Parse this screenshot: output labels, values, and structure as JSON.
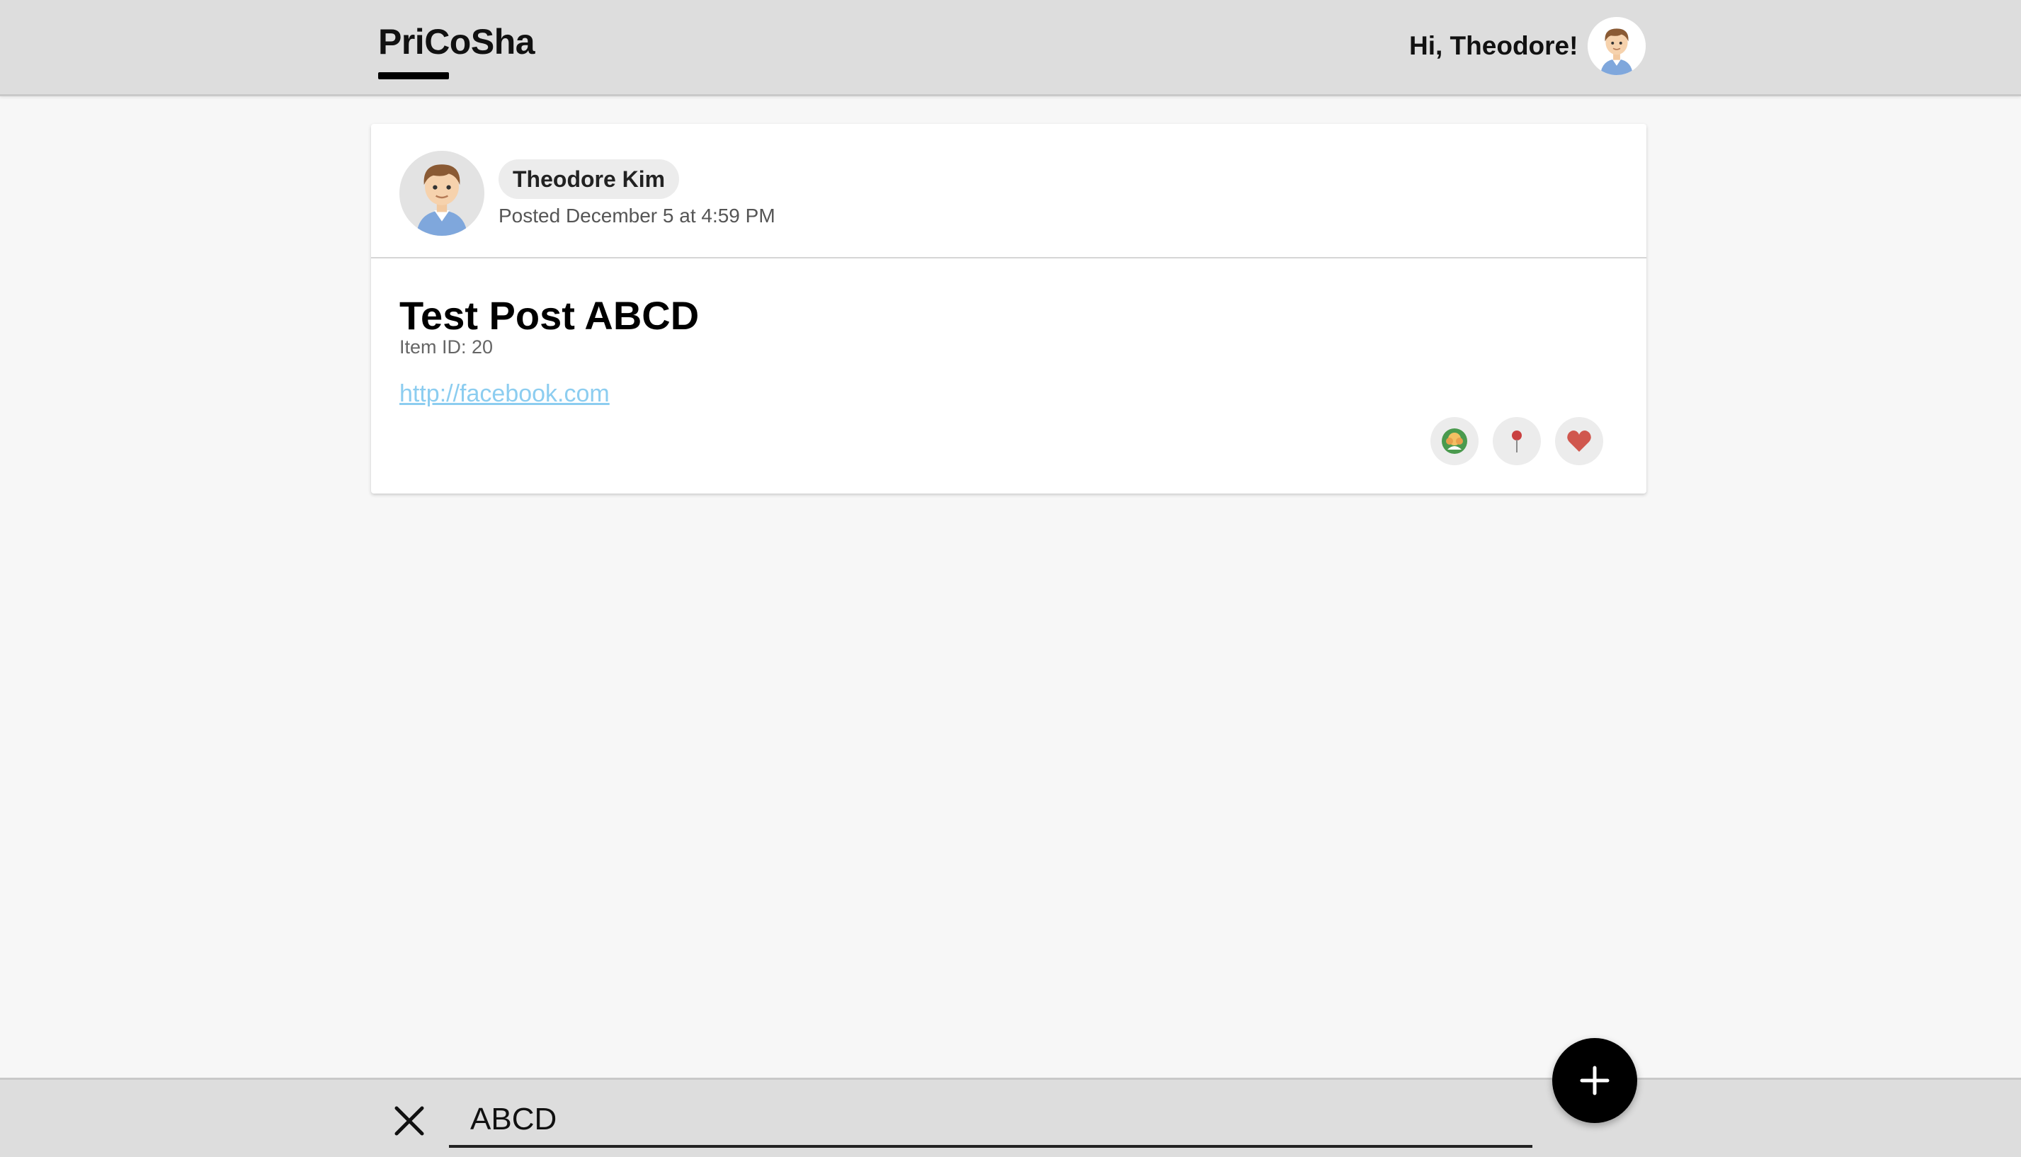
{
  "header": {
    "brand": "PriCoSha",
    "greeting": "Hi, Theodore!",
    "avatar_icon": "boy-avatar-icon"
  },
  "post": {
    "author": "Theodore Kim",
    "timestamp": "Posted December 5 at 4:59 PM",
    "title": "Test Post ABCD",
    "item_id": "Item ID: 20",
    "link": "http://facebook.com",
    "actions": [
      {
        "icon": "friend-group-icon"
      },
      {
        "icon": "pin-icon"
      },
      {
        "icon": "heart-icon"
      }
    ]
  },
  "search": {
    "value": "ABCD",
    "close_icon": "close-icon"
  },
  "fab": {
    "icon": "plus-icon"
  },
  "colors": {
    "bar_background": "#dddddd",
    "page_background": "#f7f7f7",
    "link": "#8ccdf0",
    "heart": "#d0574e",
    "pin": "#c94040"
  }
}
